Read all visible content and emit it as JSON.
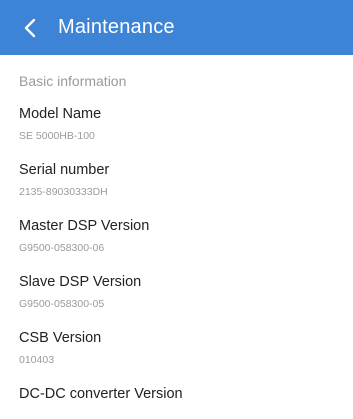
{
  "header": {
    "title": "Maintenance",
    "back_icon": "chevron-left-icon",
    "background": "#3d84d6"
  },
  "section": {
    "title": "Basic information"
  },
  "items": [
    {
      "label": "Model Name",
      "value": "SE 5000HB-100"
    },
    {
      "label": "Serial number",
      "value": "2135-89030333DH"
    },
    {
      "label": "Master DSP Version",
      "value": "G9500-058300-06"
    },
    {
      "label": "Slave DSP Version",
      "value": "G9500-058300-05"
    },
    {
      "label": "CSB Version",
      "value": "010403"
    },
    {
      "label": "DC-DC converter Version",
      "value": ""
    }
  ]
}
